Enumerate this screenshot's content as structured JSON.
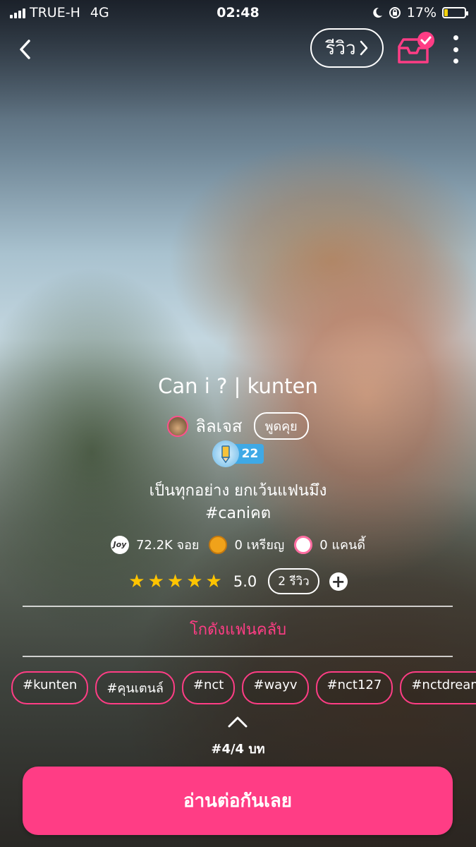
{
  "status_bar": {
    "carrier": "TRUE-H",
    "network": "4G",
    "time": "02:48",
    "battery_percent": "17%",
    "battery_level": 0.17,
    "icons": [
      "signal-icon",
      "moon-icon",
      "rotation-lock-icon",
      "battery-icon"
    ]
  },
  "nav": {
    "back_icon": "chevron-left-icon",
    "review_label": "รีวิว",
    "shelf_icon": "shelf-check-icon",
    "more_icon": "more-vertical-icon"
  },
  "story": {
    "title": "Can i ? | kunten",
    "author": "ลิลเจส",
    "talk_label": "พูดคุย",
    "level": "22",
    "description_line1": "เป็นทุกอย่าง ยกเว้นแฟนมึง",
    "description_line2": "#caniคต"
  },
  "stats": {
    "joy_value": "72.2K จอย",
    "coin_value": "0 เหรียญ",
    "candy_value": "0 แคนดี้"
  },
  "rating": {
    "stars": 5,
    "value": "5.0",
    "review_count": "2 รีวิว",
    "add_label": "+"
  },
  "fanclub_label": "โกดังแฟนคลับ",
  "tags": [
    "#kunten",
    "#คุนเตนล์",
    "#nct",
    "#wayv",
    "#nct127",
    "#nctdream"
  ],
  "chapter_info": "#4/4 บท",
  "read_button_label": "อ่านต่อกันเลย",
  "colors": {
    "accent": "#ff3d85",
    "star": "#ffc400",
    "level_ribbon": "#3fa9e6",
    "battery": "#f5d30b"
  }
}
